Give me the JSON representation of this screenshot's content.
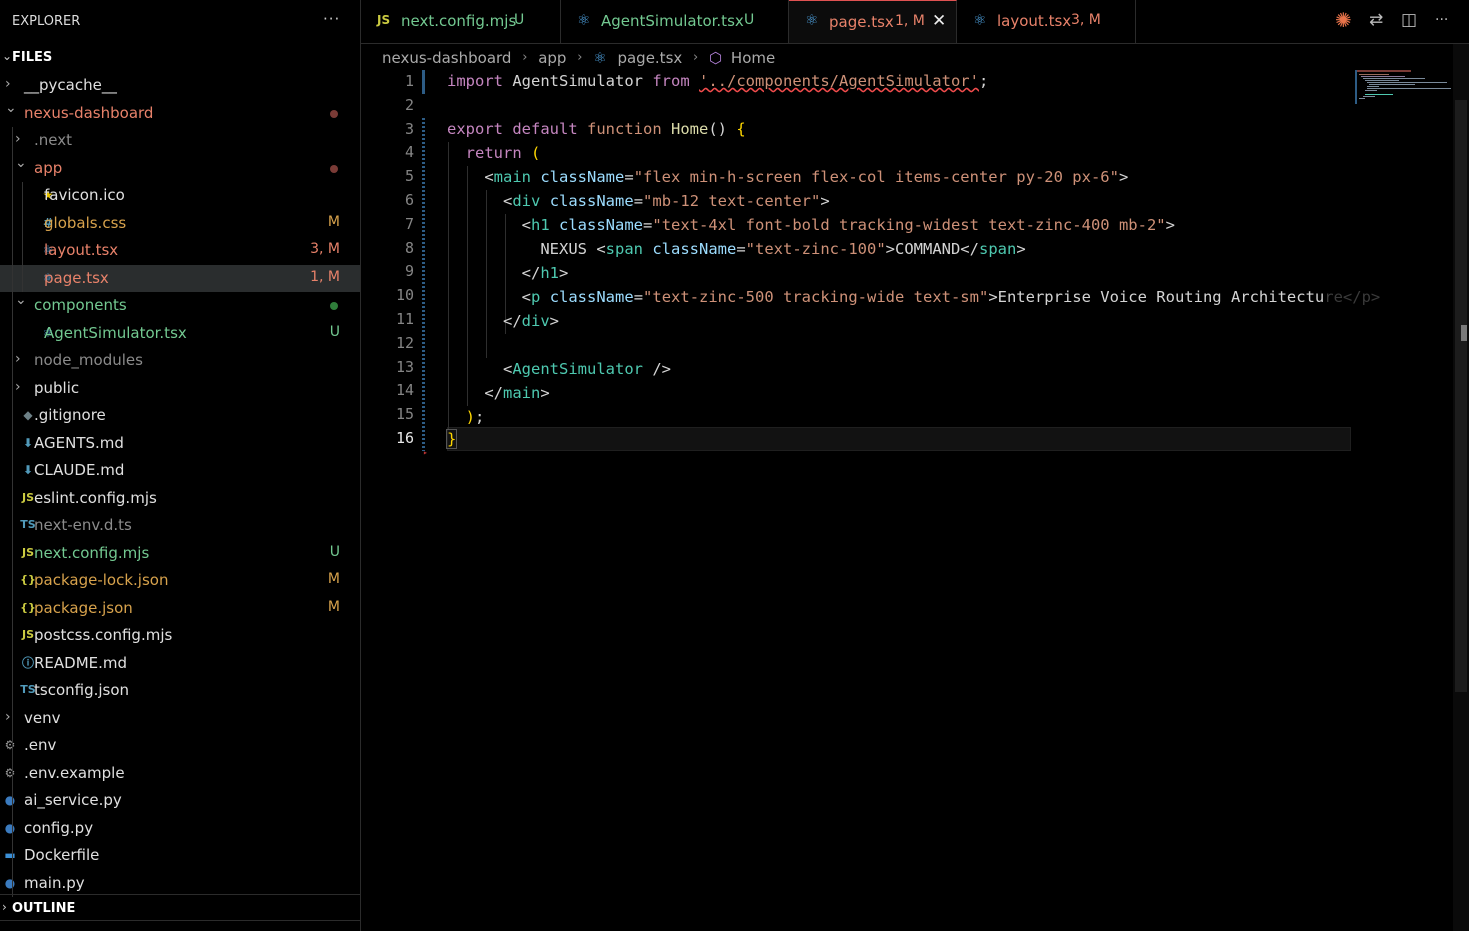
{
  "explorer": {
    "title": "EXPLORER",
    "more": "···",
    "files_label": "FILES",
    "outline_label": "OUTLINE",
    "items": [
      {
        "name": "__pycache__",
        "type": "folder",
        "expanded": false,
        "depth": 0,
        "color": "#e0e0e0"
      },
      {
        "name": "nexus-dashboard",
        "type": "folder",
        "expanded": true,
        "depth": 0,
        "color": "#e8826a",
        "dot": "#7a3b36"
      },
      {
        "name": ".next",
        "type": "folder",
        "expanded": false,
        "depth": 1,
        "color": "#8b8b8b"
      },
      {
        "name": "app",
        "type": "folder",
        "expanded": true,
        "depth": 1,
        "color": "#e8826a",
        "dot": "#7a3b36"
      },
      {
        "name": "favicon.ico",
        "type": "file",
        "icon": "star-icon",
        "glyph": "★",
        "iconColor": "#e5c100",
        "depth": 2,
        "color": "#e0e0e0"
      },
      {
        "name": "globals.css",
        "type": "file",
        "icon": "css-hash-icon",
        "glyph": "#",
        "iconColor": "#519aba",
        "depth": 2,
        "color": "#d7a24c",
        "badge": "M",
        "badgeColor": "#d7a24c"
      },
      {
        "name": "layout.tsx",
        "type": "file",
        "icon": "react-icon",
        "glyph": "⚛",
        "iconColor": "#4d9fdc",
        "depth": 2,
        "color": "#e8826a",
        "badge": "3, M",
        "badgeColor": "#e8826a"
      },
      {
        "name": "page.tsx",
        "type": "file",
        "icon": "react-icon",
        "glyph": "⚛",
        "iconColor": "#4d9fdc",
        "depth": 2,
        "color": "#e8826a",
        "badge": "1, M",
        "badgeColor": "#e8826a",
        "selected": true
      },
      {
        "name": "components",
        "type": "folder",
        "expanded": true,
        "depth": 1,
        "color": "#73c991",
        "dot": "#2f7d3a"
      },
      {
        "name": "AgentSimulator.tsx",
        "type": "file",
        "icon": "react-icon",
        "glyph": "⚛",
        "iconColor": "#4d9fdc",
        "depth": 2,
        "color": "#73c991",
        "badge": "U",
        "badgeColor": "#73c991"
      },
      {
        "name": "node_modules",
        "type": "folder",
        "expanded": false,
        "depth": 1,
        "color": "#8b8b8b"
      },
      {
        "name": "public",
        "type": "folder",
        "expanded": false,
        "depth": 1,
        "color": "#e0e0e0"
      },
      {
        "name": ".gitignore",
        "type": "file",
        "icon": "git-icon",
        "glyph": "◆",
        "iconColor": "#6d8086",
        "depth": 1,
        "color": "#e0e0e0"
      },
      {
        "name": "AGENTS.md",
        "type": "file",
        "icon": "markdown-icon",
        "glyph": "⬇",
        "iconColor": "#519aba",
        "depth": 1,
        "color": "#e0e0e0"
      },
      {
        "name": "CLAUDE.md",
        "type": "file",
        "icon": "markdown-icon",
        "glyph": "⬇",
        "iconColor": "#519aba",
        "depth": 1,
        "color": "#e0e0e0"
      },
      {
        "name": "eslint.config.mjs",
        "type": "file",
        "icon": "js-icon",
        "glyph": "JS",
        "iconColor": "#cbcb41",
        "depth": 1,
        "color": "#e0e0e0"
      },
      {
        "name": "next-env.d.ts",
        "type": "file",
        "icon": "ts-icon",
        "glyph": "TS",
        "iconColor": "#519aba",
        "depth": 1,
        "color": "#8b8b8b"
      },
      {
        "name": "next.config.mjs",
        "type": "file",
        "icon": "js-icon",
        "glyph": "JS",
        "iconColor": "#cbcb41",
        "depth": 1,
        "color": "#73c991",
        "badge": "U",
        "badgeColor": "#73c991"
      },
      {
        "name": "package-lock.json",
        "type": "file",
        "icon": "json-icon",
        "glyph": "{}",
        "iconColor": "#cbcb41",
        "depth": 1,
        "color": "#d7a24c",
        "badge": "M",
        "badgeColor": "#d7a24c"
      },
      {
        "name": "package.json",
        "type": "file",
        "icon": "json-icon",
        "glyph": "{}",
        "iconColor": "#cbcb41",
        "depth": 1,
        "color": "#d7a24c",
        "badge": "M",
        "badgeColor": "#d7a24c"
      },
      {
        "name": "postcss.config.mjs",
        "type": "file",
        "icon": "js-icon",
        "glyph": "JS",
        "iconColor": "#cbcb41",
        "depth": 1,
        "color": "#e0e0e0"
      },
      {
        "name": "README.md",
        "type": "file",
        "icon": "info-icon",
        "glyph": "ⓘ",
        "iconColor": "#519aba",
        "depth": 1,
        "color": "#e0e0e0"
      },
      {
        "name": "tsconfig.json",
        "type": "file",
        "icon": "tsconfig-icon",
        "glyph": "TS",
        "iconColor": "#519aba",
        "depth": 1,
        "color": "#e0e0e0"
      },
      {
        "name": "venv",
        "type": "folder",
        "expanded": false,
        "depth": 0,
        "color": "#e0e0e0"
      },
      {
        "name": ".env",
        "type": "file",
        "icon": "gear-icon",
        "glyph": "⚙",
        "iconColor": "#9a9a9a",
        "depth": 0,
        "color": "#e0e0e0"
      },
      {
        "name": ".env.example",
        "type": "file",
        "icon": "gear-icon",
        "glyph": "⚙",
        "iconColor": "#9a9a9a",
        "depth": 0,
        "color": "#e0e0e0"
      },
      {
        "name": "ai_service.py",
        "type": "file",
        "icon": "python-icon",
        "glyph": "●",
        "iconColor": "#3b7bbf",
        "depth": 0,
        "color": "#e0e0e0"
      },
      {
        "name": "config.py",
        "type": "file",
        "icon": "python-icon",
        "glyph": "●",
        "iconColor": "#3b7bbf",
        "depth": 0,
        "color": "#e0e0e0"
      },
      {
        "name": "Dockerfile",
        "type": "file",
        "icon": "docker-icon",
        "glyph": "▬",
        "iconColor": "#3b8fd6",
        "depth": 0,
        "color": "#e0e0e0"
      },
      {
        "name": "main.py",
        "type": "file",
        "icon": "python-icon",
        "glyph": "●",
        "iconColor": "#3b7bbf",
        "depth": 0,
        "color": "#e0e0e0"
      }
    ]
  },
  "tabs": [
    {
      "icon": "js-icon",
      "glyph": "JS",
      "iconColor": "#cbcb41",
      "name": "next.config.mjs",
      "status": "U",
      "color": "#73c991",
      "active": false
    },
    {
      "icon": "react-icon",
      "glyph": "⚛",
      "iconColor": "#4d9fdc",
      "name": "AgentSimulator.tsx",
      "status": "U",
      "color": "#73c991",
      "active": false
    },
    {
      "icon": "react-icon",
      "glyph": "⚛",
      "iconColor": "#4d9fdc",
      "name": "page.tsx",
      "status": "1, M",
      "color": "#e8826a",
      "active": true
    },
    {
      "icon": "react-icon",
      "glyph": "⚛",
      "iconColor": "#4d9fdc",
      "name": "layout.tsx",
      "status": "3, M",
      "color": "#e8826a",
      "active": false
    }
  ],
  "toolbar": {
    "claude": "✺",
    "compare": "⇄",
    "split": "◫",
    "more": "···"
  },
  "breadcrumb": {
    "parts": [
      "nexus-dashboard",
      "app",
      "page.tsx",
      "Home"
    ]
  },
  "editor": {
    "line_numbers": [
      "1",
      "2",
      "3",
      "4",
      "5",
      "6",
      "7",
      "8",
      "9",
      "10",
      "11",
      "12",
      "13",
      "14",
      "15",
      "16"
    ],
    "current_line": "16"
  },
  "colors": {
    "modified": "#d7a24c",
    "untracked": "#73c991",
    "error": "#e8826a",
    "active_tab_border": "#e05252"
  }
}
